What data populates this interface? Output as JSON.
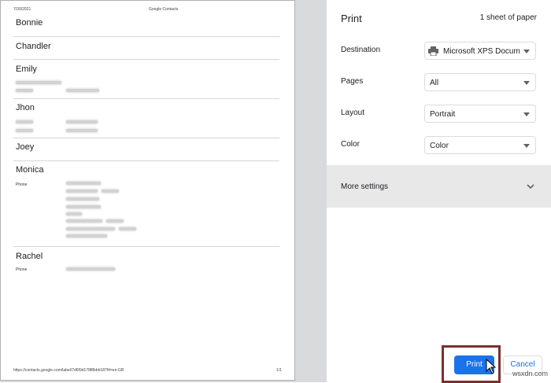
{
  "preview": {
    "date": "7/30/2021",
    "heading": "Google Contacts",
    "footer_url": "https://contacts.google.com/label/7d6f9d178f8bbb187f4=en-GB",
    "page_number": "1/1",
    "contacts": [
      {
        "name": "Bonnie"
      },
      {
        "name": "Chandler"
      },
      {
        "name": "Emily"
      },
      {
        "name": "Jhon"
      },
      {
        "name": "Joey"
      },
      {
        "name": "Monica",
        "field_label": "Phone"
      },
      {
        "name": "Rachel",
        "field_label": "Phone"
      }
    ]
  },
  "settings": {
    "title": "Print",
    "sheet_count": "1 sheet of paper",
    "rows": [
      {
        "label": "Destination",
        "value": "Microsoft XPS Docum",
        "icon": "printer-icon"
      },
      {
        "label": "Pages",
        "value": "All"
      },
      {
        "label": "Layout",
        "value": "Portrait"
      },
      {
        "label": "Color",
        "value": "Color"
      }
    ],
    "more_settings": "More settings",
    "print_label": "Print",
    "cancel_label": "Cancel",
    "accent_color": "#1a73e8",
    "highlight_color": "#7a3030"
  },
  "watermark": "wsxdn.com"
}
